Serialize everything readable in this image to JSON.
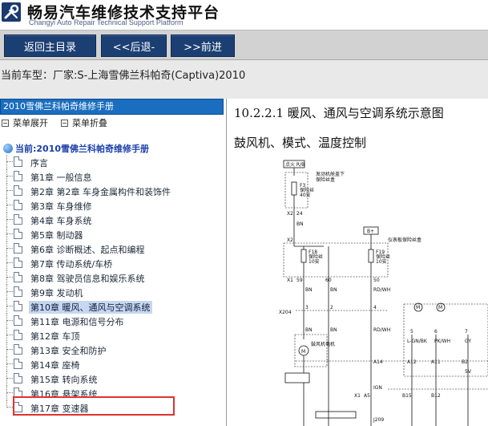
{
  "header": {
    "title": "畅易汽车维修技术支持平台",
    "subtitle": "Changyi Auto Repair Technical Support Platform"
  },
  "toolbar": {
    "home_label": "返回主目录",
    "back_label": "<<后退-",
    "forward_label": ">>前进"
  },
  "info": {
    "vehicle_label": "当前车型：",
    "vehicle_value": "厂家:S-上海雪佛兰科帕奇(Captiva)2010"
  },
  "sidebar": {
    "manual_title": "2010雪佛兰科帕奇维修手册",
    "expand_label": "菜单展开",
    "collapse_label": "菜单折叠",
    "current_label": "当前:2010雪佛兰科帕奇维修手册",
    "items": [
      {
        "label": "序言"
      },
      {
        "label": "第1章 一般信息"
      },
      {
        "label": "第2章 第2章 车身金属构件和装饰件"
      },
      {
        "label": "第3章 车身维修"
      },
      {
        "label": "第4章 车身系统"
      },
      {
        "label": "第5章 制动器"
      },
      {
        "label": "第6章 诊断概述、起点和编程"
      },
      {
        "label": "第7章 传动系统/车桥"
      },
      {
        "label": "第8章 驾驶员信息和娱乐系统"
      },
      {
        "label": "第9章 发动机"
      },
      {
        "label": "第10章 暖风、通风与空调系统",
        "selected": true
      },
      {
        "label": "第11章 电源和信号分布"
      },
      {
        "label": "第12章 车顶"
      },
      {
        "label": "第13章 安全和防护"
      },
      {
        "label": "第14章 座椅"
      },
      {
        "label": "第15章 转向系统"
      },
      {
        "label": "第16章 悬架系统"
      },
      {
        "label": "第17章 变速器"
      }
    ]
  },
  "content": {
    "section_title": "10.2.2.1 暖风、通风与空调系统示意图",
    "diagram_title": "鼓风机、模式、温度控制"
  },
  "diagram": {
    "labels": {
      "hot": "点火 R/B",
      "fuse_box1": "发动机舱盖下",
      "fuse_box2": "保险丝盒",
      "f3_name": "F3",
      "f3_desc": "保险丝",
      "f3_amp": "40安",
      "bplus": "B+",
      "ip_fuse": "仪表板保险丝盒",
      "f18_name": "F18",
      "f18_desc": "保险丝",
      "f18_amp": "10安",
      "f19_name": "F19",
      "f19_desc": "保险丝",
      "f19_amp": "10安",
      "motor": "鼓风机电机",
      "x2": "X2",
      "x1": "X1",
      "x204": "X204",
      "bn": "BN",
      "rdwh": "RD/WH",
      "lgnbk": "L-GN/BK",
      "pkwh": "PK/WH",
      "gy": "GY",
      "ign": "IGN",
      "n24": "24",
      "n59": "59",
      "n60": "60",
      "n50": "50",
      "n3": "3",
      "n2": "2",
      "n4": "4",
      "n1": "1",
      "n5": "5",
      "n6": "6",
      "n7": "7",
      "n8": "8",
      "a14": "A14",
      "a12": "A12",
      "a11": "A11",
      "b2": "B2",
      "sv": "5V",
      "a5": "A5",
      "b15": "B15",
      "b12": "B12",
      "j209": "J209"
    }
  }
}
